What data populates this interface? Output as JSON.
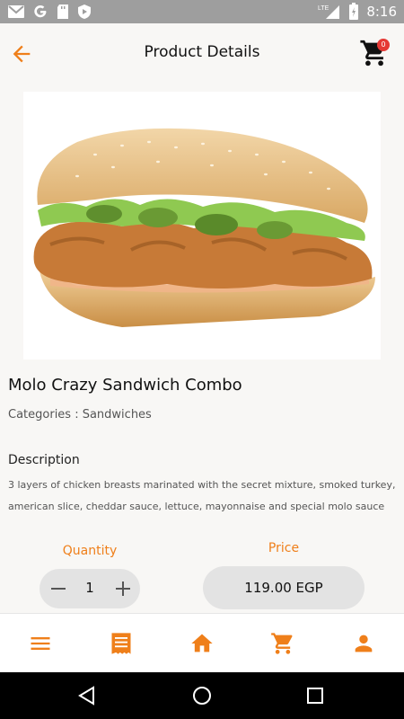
{
  "status_bar": {
    "time": "8:16",
    "network": "LTE",
    "icons": [
      "gmail-icon",
      "google-icon",
      "sd-card-icon",
      "shield-icon",
      "signal-icon",
      "battery-icon"
    ]
  },
  "header": {
    "title": "Product Details",
    "cart_count": "0"
  },
  "product": {
    "name": "Molo Crazy Sandwich Combo",
    "category": "Categories : Sandwiches",
    "description_heading": "Description",
    "description": "3 layers of chicken breasts marinated with the secret mixture, smoked turkey, american slice, cheddar sauce, lettuce, mayonnaise and special molo sauce"
  },
  "order": {
    "quantity_label": "Quantity",
    "quantity": "1",
    "price_label": "Price",
    "price": "119.00 EGP"
  },
  "bottom_nav": [
    "menu-icon",
    "receipt-icon",
    "home-icon",
    "cart-icon",
    "person-icon"
  ],
  "colors": {
    "accent": "#ef7f1a",
    "badge": "#e53935",
    "status_bar": "#9e9e9e",
    "background": "#f8f7f5"
  }
}
